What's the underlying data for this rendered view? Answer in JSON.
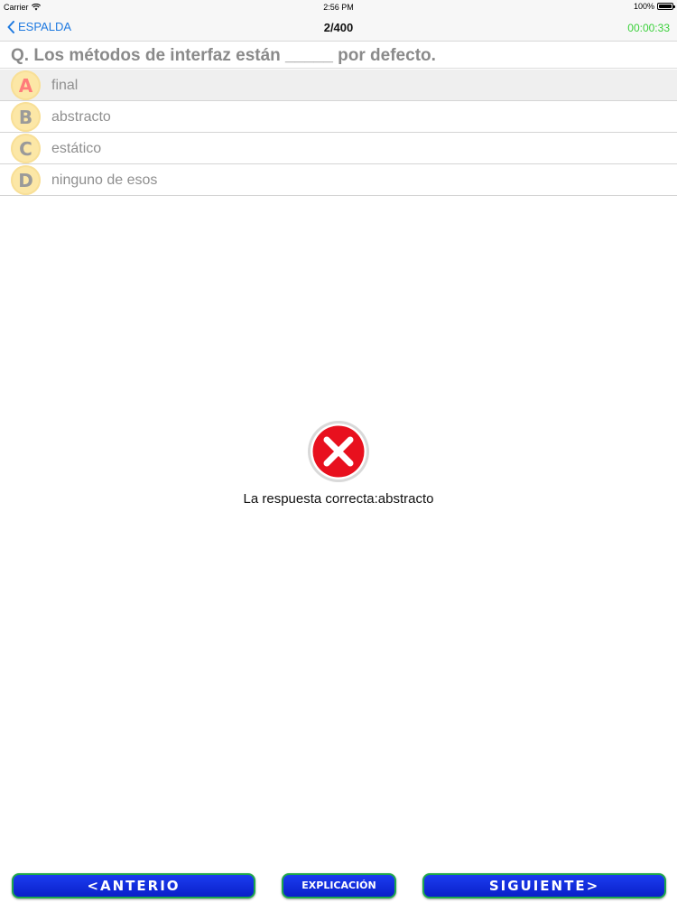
{
  "status_bar": {
    "carrier": "Carrier",
    "time": "2:56 PM",
    "battery": "100%"
  },
  "nav": {
    "back_label": "ESPALDA",
    "title": "2/400",
    "timer": "00:00:33",
    "timer_color": "#3bd13b",
    "back_color": "#1f7ae0"
  },
  "question": {
    "text": "Q. Los métodos de interfaz están _____ por defecto."
  },
  "options": [
    {
      "letter": "A",
      "text": "final",
      "selected": true
    },
    {
      "letter": "B",
      "text": "abstracto",
      "selected": false
    },
    {
      "letter": "C",
      "text": "estático",
      "selected": false
    },
    {
      "letter": "D",
      "text": "ninguno de esos",
      "selected": false
    }
  ],
  "result": {
    "icon": "wrong-x-icon",
    "text": "La respuesta correcta:abstracto",
    "icon_color": "#e8101e"
  },
  "buttons": {
    "previous": "<ANTERIO",
    "explanation": "EXPLICACIÓN",
    "next": "SIGUIENTE>"
  }
}
